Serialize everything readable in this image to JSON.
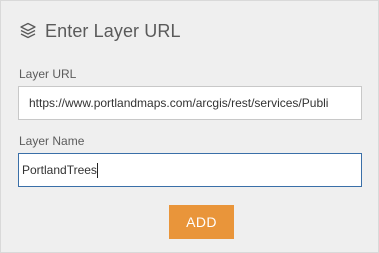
{
  "header": {
    "icon": "layers-icon",
    "title": "Enter Layer URL"
  },
  "layer_url": {
    "label": "Layer URL",
    "value": "https://www.portlandmaps.com/arcgis/rest/services/Publi"
  },
  "layer_name": {
    "label": "Layer Name",
    "value": "PortlandTrees"
  },
  "add_button": {
    "label": "ADD"
  },
  "colors": {
    "accent": "#e9953a",
    "focus_border": "#3a6fa8",
    "panel_bg": "#efefef"
  }
}
